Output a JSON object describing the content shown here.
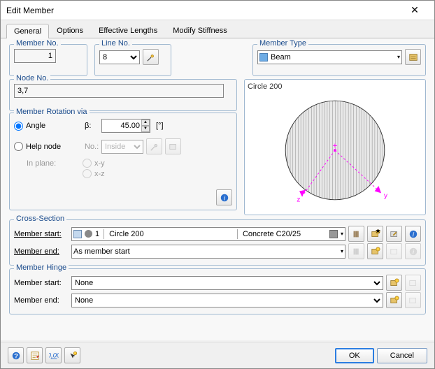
{
  "window": {
    "title": "Edit Member"
  },
  "tabs": [
    "General",
    "Options",
    "Effective Lengths",
    "Modify Stiffness"
  ],
  "general": {
    "memberNo": {
      "label": "Member No.",
      "value": "1"
    },
    "lineNo": {
      "label": "Line No.",
      "value": "8"
    },
    "memberType": {
      "label": "Member Type",
      "value": "Beam"
    },
    "nodeNo": {
      "label": "Node No.",
      "value": "3,7"
    },
    "rotation": {
      "label": "Member Rotation via",
      "angle": {
        "label": "Angle",
        "symbol": "β:",
        "value": "45.00",
        "unit": "[°]"
      },
      "help": {
        "label": "Help node",
        "noLabel": "No.:",
        "value": "Inside",
        "inPlane": "In plane:",
        "xy": "x-y",
        "xz": "x-z"
      }
    }
  },
  "preview": {
    "title": "Circle 200",
    "axisZ": "z",
    "axisY": "y"
  },
  "crossSection": {
    "label": "Cross-Section",
    "startLabel": "Member start:",
    "endLabel": "Member end:",
    "start": {
      "id": "1",
      "name": "Circle 200",
      "material": "Concrete C20/25"
    },
    "end": {
      "value": "As member start"
    }
  },
  "hinge": {
    "label": "Member Hinge",
    "startLabel": "Member start:",
    "endLabel": "Member end:",
    "start": "None",
    "end": "None"
  },
  "footer": {
    "ok": "OK",
    "cancel": "Cancel"
  }
}
